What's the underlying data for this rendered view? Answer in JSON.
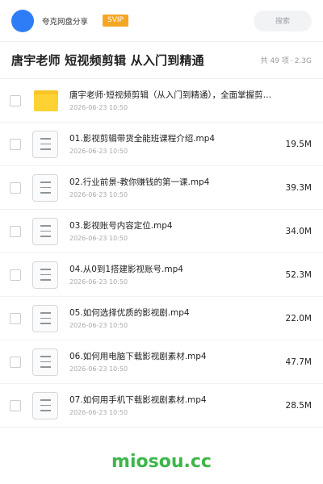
{
  "header": {
    "brand": "夸克网盘分享",
    "badge": "SVIP",
    "search_label": "搜索"
  },
  "share": {
    "title": "唐宇老师 短视频剪辑 从入门到精通",
    "count": "共 49 项",
    "dot": "·",
    "size": "2.3G"
  },
  "files": [
    {
      "name": "唐宇老师·短视频剪辑（从入门到精通），全面掌握剪辑技能",
      "date": "2026-06-23 10:50",
      "size": "",
      "type": "folder"
    },
    {
      "name": "01.影视剪辑带货全能班课程介绍.mp4",
      "date": "2026-06-23 10:50",
      "size": "19.5M",
      "type": "file"
    },
    {
      "name": "02.行业前景-教你赚钱的第一课.mp4",
      "date": "2026-06-23 10:50",
      "size": "39.3M",
      "type": "file"
    },
    {
      "name": "03.影视账号内容定位.mp4",
      "date": "2026-06-23 10:50",
      "size": "34.0M",
      "type": "file"
    },
    {
      "name": "04.从0到1搭建影视账号.mp4",
      "date": "2026-06-23 10:50",
      "size": "52.3M",
      "type": "file"
    },
    {
      "name": "05.如何选择优质的影视剧.mp4",
      "date": "2026-06-23 10:50",
      "size": "22.0M",
      "type": "file"
    },
    {
      "name": "06.如何用电脑下载影视剧素材.mp4",
      "date": "2026-06-23 10:50",
      "size": "47.7M",
      "type": "file"
    },
    {
      "name": "07.如何用手机下载影视剧素材.mp4",
      "date": "2026-06-23 10:50",
      "size": "28.5M",
      "type": "file"
    }
  ],
  "footer": {
    "watermark": "miosou.cc"
  }
}
